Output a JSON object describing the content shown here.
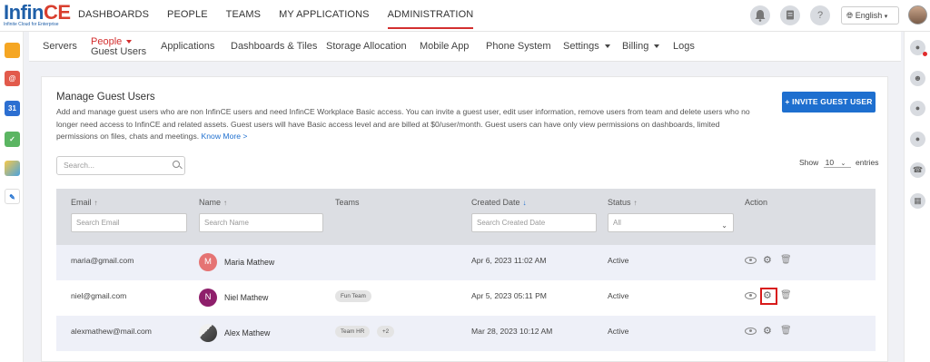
{
  "brand": {
    "logo_main_a": "Inf",
    "logo_main_b": "in",
    "logo_main_c": "CE",
    "logo_sub": "Infinite Cloud for Enterprise"
  },
  "topnav": [
    "DASHBOARDS",
    "PEOPLE",
    "TEAMS",
    "MY APPLICATIONS",
    "ADMINISTRATION"
  ],
  "top_icons": {
    "help": "?",
    "language": "English"
  },
  "subnav": {
    "servers": "Servers",
    "people": "People",
    "people_sub": "Guest Users",
    "applications": "Applications",
    "dashboards_tiles": "Dashboards & Tiles",
    "storage": "Storage Allocation",
    "mobile": "Mobile App",
    "phone": "Phone System",
    "settings": "Settings",
    "billing": "Billing",
    "logs": "Logs"
  },
  "leftrail": {
    "calendar_day": "31"
  },
  "page": {
    "title": "Manage Guest Users",
    "description": "Add and manage guest users who are non InfinCE users and need InfinCE Workplace Basic access. You can invite a guest user, edit user information, remove users from team and delete users who no longer need access to InfinCE and related assets. Guest users will have Basic access level and are billed at $0/user/month. Guest users can have only view permissions on dashboards, limited permissions on files, chats and meetings.",
    "know_more": "Know More >",
    "invite_button": "+ INVITE GUEST USER",
    "search_placeholder": "Search...",
    "show_label": "Show",
    "show_value": "10",
    "entries_label": "entries"
  },
  "table": {
    "headers": {
      "email": "Email",
      "name": "Name",
      "teams": "Teams",
      "created": "Created Date",
      "status": "Status",
      "action": "Action"
    },
    "filters": {
      "email": "Search Email",
      "name": "Search Name",
      "created": "Search Created Date",
      "status": "All"
    },
    "rows": [
      {
        "email": "maria@gmail.com",
        "initial": "M",
        "name": "Maria Mathew",
        "teams": [],
        "created": "Apr 6, 2023 11:02 AM",
        "status": "Active"
      },
      {
        "email": "niel@gmail.com",
        "initial": "N",
        "name": "Niel Mathew",
        "teams": [
          "Fun Team"
        ],
        "created": "Apr 5, 2023 05:11 PM",
        "status": "Active"
      },
      {
        "email": "alexmathew@mail.com",
        "initial": "",
        "name": "Alex Mathew",
        "teams": [
          "Team HR",
          "+2"
        ],
        "created": "Mar 28, 2023 10:12 AM",
        "status": "Active"
      }
    ]
  },
  "colors": {
    "accent": "#d32f2f",
    "primary": "#1e6fcf",
    "avatar_m": "#e57373",
    "avatar_n": "#8e1f6b"
  }
}
